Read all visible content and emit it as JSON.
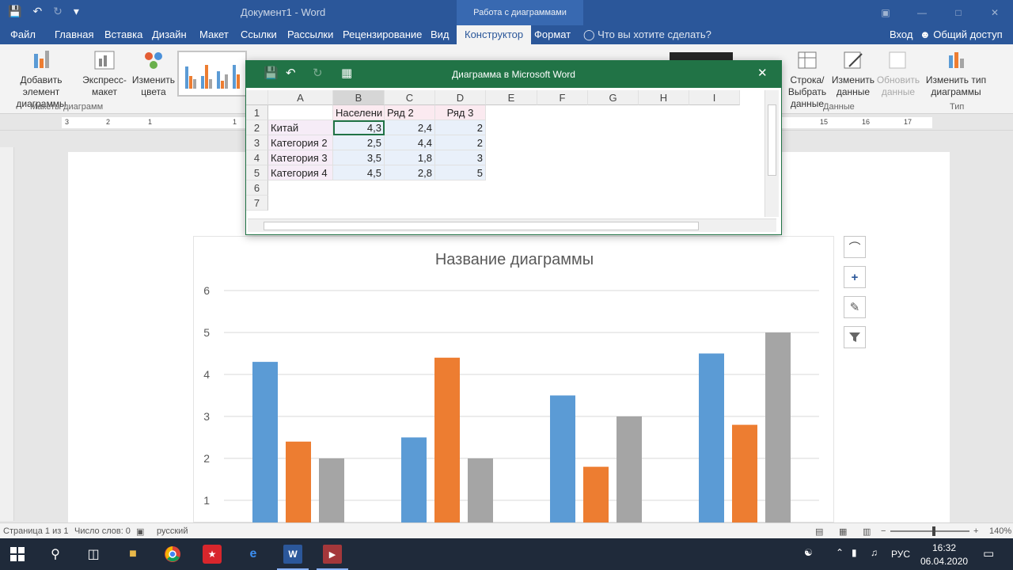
{
  "titlebar": {
    "doc_title": "Документ1 - Word",
    "context_title": "Работа с диаграммами",
    "save_icon": "save-icon",
    "undo_icon": "undo-icon",
    "redo_icon": "redo-icon"
  },
  "tabs": [
    {
      "label": "Файл"
    },
    {
      "label": "Главная"
    },
    {
      "label": "Вставка"
    },
    {
      "label": "Дизайн"
    },
    {
      "label": "Макет"
    },
    {
      "label": "Ссылки"
    },
    {
      "label": "Рассылки"
    },
    {
      "label": "Рецензирование"
    },
    {
      "label": "Вид"
    },
    {
      "label": "Конструктор",
      "active": true
    },
    {
      "label": "Формат"
    }
  ],
  "tellme": "Что вы хотите сделать?",
  "signin": "Вход",
  "share": "Общий доступ",
  "ribbon": {
    "add_element": "Добавить элемент диаграммы",
    "express_layout": "Экспресс-макет",
    "change_colors": "Изменить цвета",
    "group_layouts": "Макеты диаграмм",
    "switch_row_col": "Строка/ Выбрать",
    "select_data": "данные",
    "edit_data": "Изменить данные",
    "refresh_data": "Обновить данные",
    "group_data": "Данные",
    "change_type": "Изменить тип диаграммы",
    "group_type": "Тип"
  },
  "ruler": {
    "left_ticks": [
      "3",
      "2",
      "1",
      "1"
    ],
    "right_ticks": [
      "15",
      "16",
      "17"
    ]
  },
  "excel": {
    "title": "Диаграмма в Microsoft Word",
    "columns": [
      "A",
      "B",
      "C",
      "D",
      "E",
      "F",
      "G",
      "H",
      "I"
    ],
    "rows": [
      [
        "1",
        "",
        "Населени",
        "Ряд 2",
        "Ряд 3"
      ],
      [
        "2",
        "Китай",
        "4,3",
        "2,4",
        "2"
      ],
      [
        "3",
        "Категория 2",
        "2,5",
        "4,4",
        "2"
      ],
      [
        "4",
        "Категория 3",
        "3,5",
        "1,8",
        "3"
      ],
      [
        "5",
        "Категория 4",
        "4,5",
        "2,8",
        "5"
      ],
      [
        "6",
        "",
        "",
        "",
        ""
      ],
      [
        "7",
        "",
        "",
        "",
        ""
      ]
    ]
  },
  "chart_data": {
    "type": "bar",
    "title": "Название диаграммы",
    "categories": [
      "Китай",
      "Категория 2",
      "Категория 3",
      "Категория 4"
    ],
    "series": [
      {
        "name": "Населени",
        "color": "#5b9bd5",
        "values": [
          4.3,
          2.5,
          3.5,
          4.5
        ]
      },
      {
        "name": "Ряд 2",
        "color": "#ed7d31",
        "values": [
          2.4,
          4.4,
          1.8,
          2.8
        ]
      },
      {
        "name": "Ряд 3",
        "color": "#a5a5a5",
        "values": [
          2,
          2,
          3,
          5
        ]
      }
    ],
    "yticks": [
      "1",
      "2",
      "3",
      "4",
      "5",
      "6"
    ],
    "ylim": [
      0,
      6
    ],
    "grid": true
  },
  "status": {
    "page": "Страница 1 из 1",
    "words": "Число слов: 0",
    "language": "русский",
    "zoom": "140%"
  },
  "taskbar": {
    "lang": "РУС",
    "time": "16:32",
    "date": "06.04.2020"
  }
}
